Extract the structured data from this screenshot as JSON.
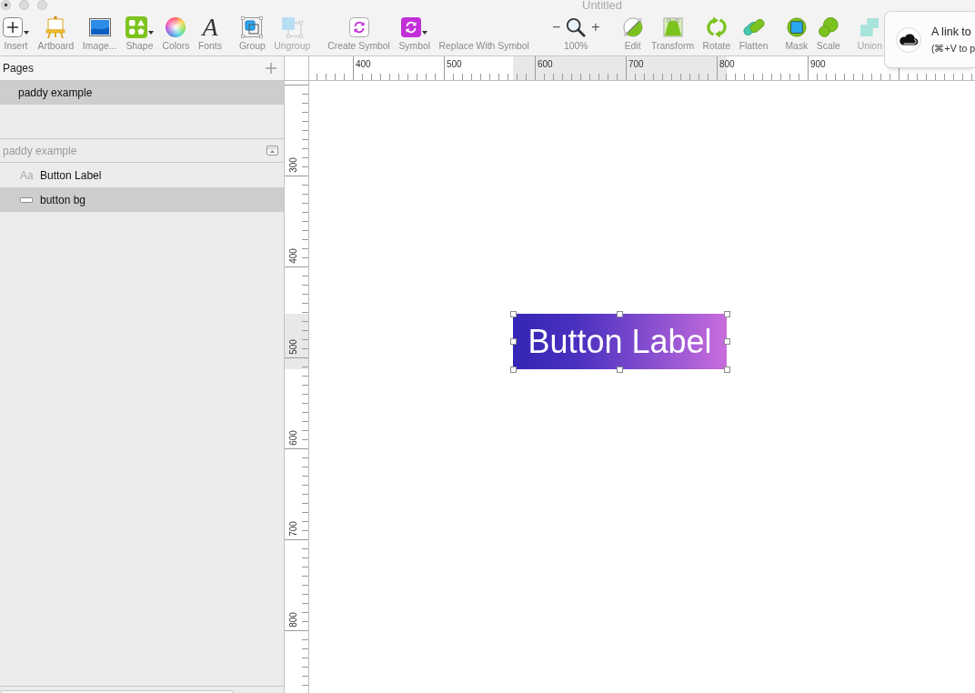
{
  "window": {
    "title": "Untitled",
    "edited": true
  },
  "toolbar": {
    "groups": [
      [
        {
          "kind": "insert",
          "label": "Insert",
          "dropdown": true,
          "disabled": false
        },
        {
          "kind": "artboard",
          "label": "Artboard",
          "dropdown": false,
          "disabled": false
        },
        {
          "kind": "image",
          "label": "Image...",
          "dropdown": false,
          "disabled": false
        },
        {
          "kind": "shape",
          "label": "Shape",
          "dropdown": true,
          "disabled": false
        },
        {
          "kind": "colors",
          "label": "Colors",
          "dropdown": false,
          "disabled": false
        },
        {
          "kind": "fonts",
          "glyph": "A",
          "label": "Fonts",
          "dropdown": false,
          "disabled": false
        }
      ],
      [
        {
          "kind": "group",
          "label": "Group",
          "dropdown": false,
          "disabled": false
        },
        {
          "kind": "ungroup",
          "label": "Ungroup",
          "dropdown": false,
          "disabled": true
        }
      ],
      [
        {
          "kind": "create_symbol",
          "label": "Create Symbol",
          "dropdown": false,
          "disabled": false
        },
        {
          "kind": "symbol",
          "label": "Symbol",
          "dropdown": true,
          "disabled": false
        },
        {
          "kind": "replace_symbol",
          "label": "Replace With Symbol",
          "dropdown": false,
          "disabled": false
        }
      ],
      [
        {
          "kind": "zoom",
          "zoom_out": "−",
          "zoom_in": "+",
          "label": "100%",
          "disabled": false
        }
      ],
      [
        {
          "kind": "edit",
          "label": "Edit",
          "dropdown": false,
          "disabled": false
        },
        {
          "kind": "transform",
          "label": "Transform",
          "dropdown": false,
          "disabled": false
        },
        {
          "kind": "rotate",
          "label": "Rotate",
          "dropdown": false,
          "disabled": false
        },
        {
          "kind": "flatten",
          "label": "Flatten",
          "dropdown": false,
          "disabled": false
        }
      ],
      [
        {
          "kind": "mask",
          "label": "Mask",
          "dropdown": false,
          "disabled": false
        },
        {
          "kind": "scale",
          "label": "Scale",
          "dropdown": false,
          "disabled": false
        }
      ],
      [
        {
          "kind": "union",
          "label": "Union",
          "dropdown": false,
          "disabled": true
        }
      ]
    ]
  },
  "pages": {
    "title": "Pages",
    "items": [
      {
        "label": "paddy example",
        "selected": true
      }
    ]
  },
  "layers": {
    "title": "paddy example",
    "items": [
      {
        "kind": "text",
        "glyph": "Aa",
        "label": "Button Label",
        "selected": false
      },
      {
        "kind": "shape",
        "label": "button bg",
        "selected": true
      }
    ]
  },
  "rulers": {
    "horizontal": [
      "400",
      "500",
      "600",
      "700",
      "800",
      "900"
    ],
    "vertical": [
      "300",
      "400",
      "500",
      "600",
      "700",
      "800"
    ]
  },
  "canvas": {
    "button": {
      "label": "Button Label",
      "selected": true
    }
  },
  "notification": {
    "title": "A link to",
    "hint": "(⌘+V to p"
  }
}
